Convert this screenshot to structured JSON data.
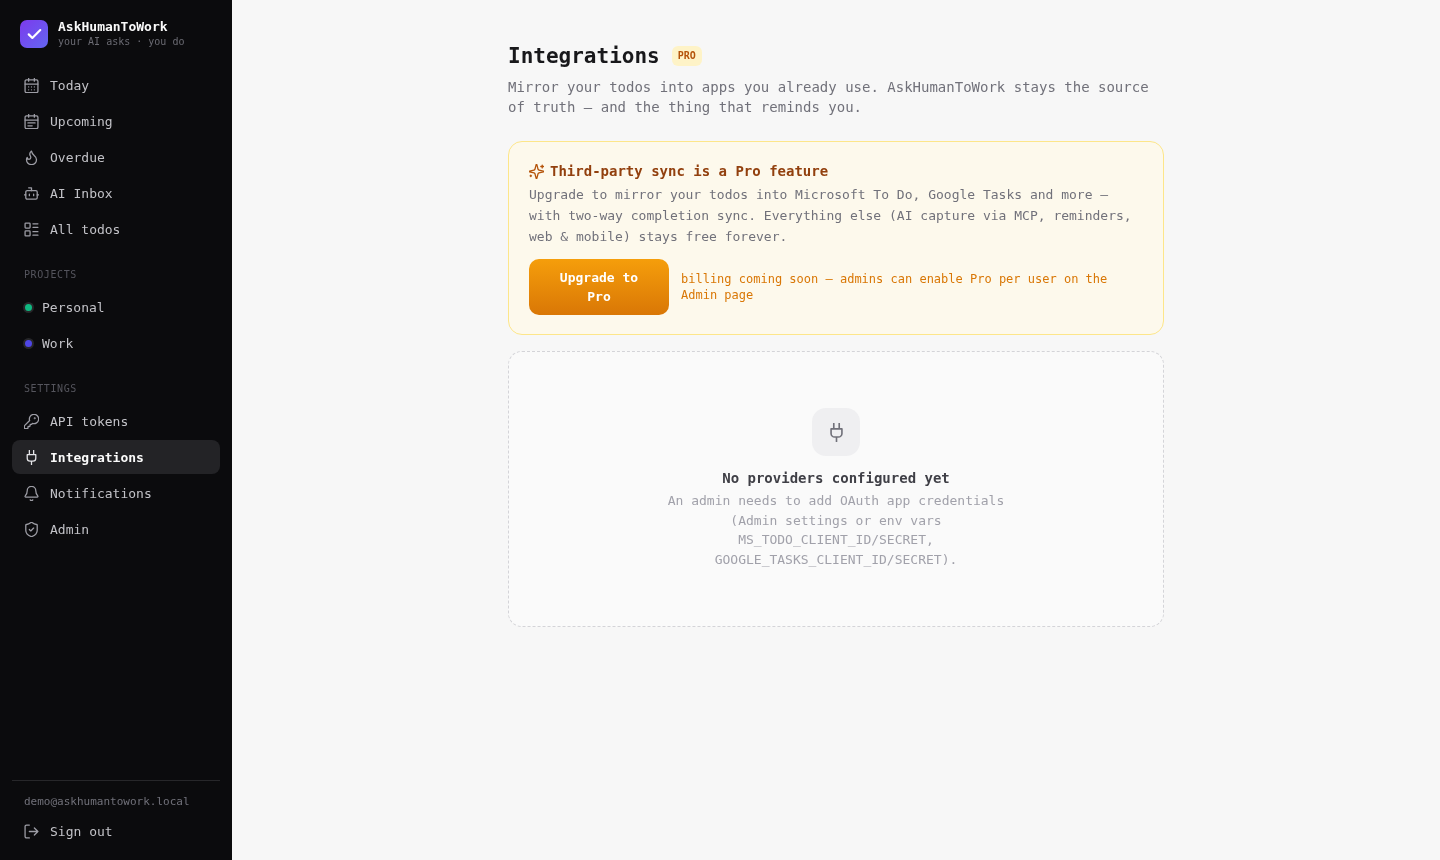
{
  "sidebar": {
    "brand": {
      "name": "AskHumanToWork",
      "tagline": "your AI asks · you do"
    },
    "nav": [
      {
        "label": "Today",
        "selected": false
      },
      {
        "label": "Upcoming",
        "selected": false
      },
      {
        "label": "Overdue",
        "selected": false
      },
      {
        "label": "AI Inbox",
        "selected": false
      },
      {
        "label": "All todos",
        "selected": false
      }
    ],
    "projects": {
      "heading": "PROJECTS",
      "items": [
        {
          "label": "Personal",
          "color": "#10b981",
          "selected": false
        },
        {
          "label": "Work",
          "color": "#4f46e5",
          "selected": false
        }
      ]
    },
    "settings": {
      "heading": "SETTINGS",
      "items": [
        {
          "label": "API tokens",
          "selected": false
        },
        {
          "label": "Integrations",
          "selected": true
        },
        {
          "label": "Notifications",
          "selected": false
        },
        {
          "label": "Admin",
          "selected": false
        }
      ]
    },
    "footer": {
      "email": "demo@askhumantowork.local",
      "sign_out": "Sign out"
    }
  },
  "main": {
    "title": "Integrations",
    "badge": "PRO",
    "description": "Mirror your todos into apps you already use. AskHumanToWork stays the source of truth — and the thing that reminds you.",
    "pro_card": {
      "title": "Third-party sync is a Pro feature",
      "body": "Upgrade to mirror your todos into Microsoft To Do, Google Tasks and more — with two-way completion sync. Everything else (AI capture via MCP, reminders, web & mobile) stays free forever.",
      "button": "Upgrade to Pro",
      "note": "billing coming soon — admins can enable Pro per user on the Admin page"
    },
    "empty_state": {
      "title": "No providers configured yet",
      "description": "An admin needs to add OAuth app credentials (Admin settings or env vars MS_TODO_CLIENT_ID/SECRET, GOOGLE_TASKS_CLIENT_ID/SECRET)."
    }
  }
}
